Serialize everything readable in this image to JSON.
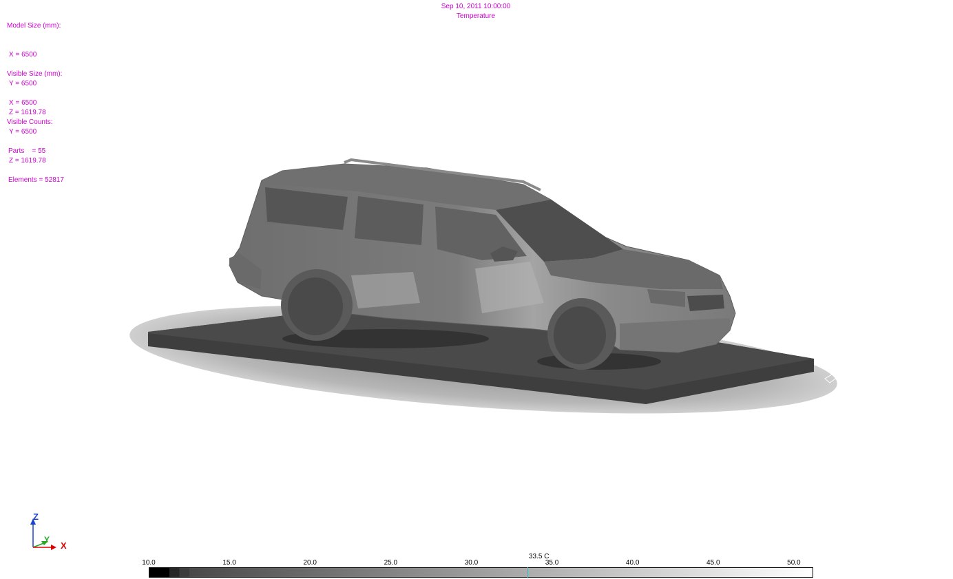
{
  "header": {
    "datetime": "Sep 10, 2011 10:00:00",
    "quantity": "Temperature"
  },
  "model_size": {
    "title": "Model Size (mm):",
    "x": "X = 6500",
    "y": "Y = 6500",
    "z": "Z = 1619.78"
  },
  "visible_size": {
    "title": "Visible Size (mm):",
    "x": "X = 6500",
    "y": "Y = 6500",
    "z": "Z = 1619.78"
  },
  "visible_counts": {
    "title": "Visible Counts:",
    "parts": "Parts    = 55",
    "elements": "Elements = 52817"
  },
  "axes": {
    "z": "Z",
    "y": "Y",
    "x": "X"
  },
  "colors": {
    "text_accent": "#cc00cc",
    "axis_z": "#1a44cc",
    "axis_y": "#22aa22",
    "axis_x": "#dd0000",
    "probe": "#2ec4c4"
  },
  "legend": {
    "ticks": [
      "10.0",
      "15.0",
      "20.0",
      "25.0",
      "30.0",
      "35.0",
      "40.0",
      "45.0",
      "50.0"
    ],
    "min": 10.0,
    "max": 51.2,
    "probe_label": "33.5 C",
    "probe_value": 33.5
  }
}
